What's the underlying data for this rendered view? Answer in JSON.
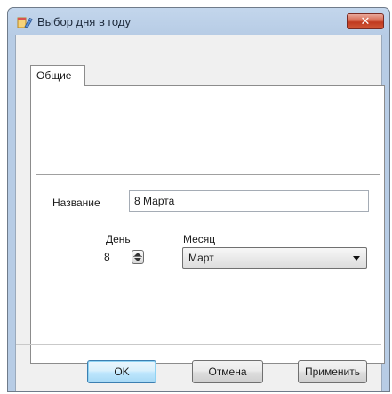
{
  "window": {
    "title": "Выбор дня в году",
    "close_glyph": "✕"
  },
  "tabs": [
    {
      "label": "Общие",
      "active": true
    }
  ],
  "form": {
    "name_label": "Название",
    "name_value": "8 Марта",
    "day_label": "День",
    "day_value": "8",
    "month_label": "Месяц",
    "month_value": "Март"
  },
  "buttons": {
    "ok": "OK",
    "cancel": "Отмена",
    "apply": "Применить"
  },
  "icons": {
    "app": "calendar-app-icon",
    "close": "close-icon",
    "spinner": "spinner-icon",
    "dropdown": "chevron-down-icon"
  },
  "colors": {
    "title_bar": "#b7cce5",
    "close_button": "#c0391f",
    "default_button_border": "#3c7fb1"
  }
}
